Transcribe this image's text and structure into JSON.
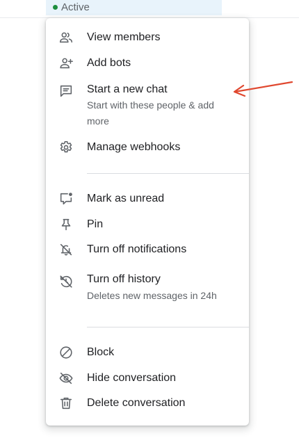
{
  "status": {
    "label": "Active",
    "dot_color": "#1e8e3e"
  },
  "menu": {
    "items": [
      {
        "label": "View members",
        "icon": "people-icon"
      },
      {
        "label": "Add bots",
        "icon": "person-add-icon"
      },
      {
        "label": "Start a new chat",
        "sublabel": "Start with these people & add more",
        "icon": "chat-icon"
      },
      {
        "label": "Manage webhooks",
        "icon": "gear-icon"
      },
      {
        "label": "Mark as unread",
        "icon": "mark-unread-icon"
      },
      {
        "label": "Pin",
        "icon": "pin-icon"
      },
      {
        "label": "Turn off notifications",
        "icon": "bell-off-icon"
      },
      {
        "label": "Turn off history",
        "sublabel": "Deletes new messages in 24h",
        "icon": "history-off-icon"
      },
      {
        "label": "Block",
        "icon": "block-icon"
      },
      {
        "label": "Hide conversation",
        "icon": "eye-off-icon"
      },
      {
        "label": "Delete conversation",
        "icon": "trash-icon"
      }
    ]
  },
  "annotation": {
    "arrow_color": "#e0482f"
  }
}
